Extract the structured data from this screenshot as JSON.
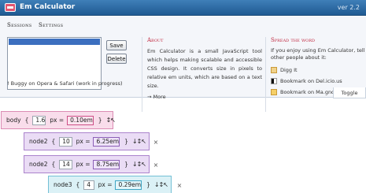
{
  "app": {
    "title": "Em Calculator",
    "version": "ver 2.2",
    "brand_color": "#2a6aa3",
    "accent_color": "#c0283f",
    "logo_icon": "em-logo-icon"
  },
  "nav": {
    "items": [
      "Sessions",
      "Settings"
    ]
  },
  "sessions": {
    "save_label": "Save",
    "delete_label": "Delete",
    "warning": "! Buggy on Opera & Safari (work in progress)"
  },
  "about": {
    "title": "About",
    "text": "Em Calculator is a small JavaScript tool which helps making scalable and accessible CSS design. It converts size in pixels to relative em units, which are based on a text size.",
    "more": "→ More"
  },
  "spread": {
    "title": "Spread the word",
    "text": "If you enjoy using Em Calculator, tell other people about it:",
    "items": [
      {
        "label": "Digg It",
        "icon": "digg-icon"
      },
      {
        "label": "Bookmark on Del.icio.us",
        "icon": "delicious-icon"
      },
      {
        "label": "Bookmark on Ma.gnolia",
        "icon": "magnolia-icon"
      }
    ]
  },
  "toggle_label": "Toggle",
  "nodes": [
    {
      "name": "body",
      "open": "{",
      "value": "1.6",
      "px": "px =",
      "em": "0.10em",
      "close": "}",
      "ctrl": "↕↖",
      "color": "#f9ddeb"
    },
    {
      "name": "node2",
      "open": "{",
      "value": "10",
      "px": "px =",
      "em": "6.25em",
      "close": "}",
      "ctrl": "↓↕↖",
      "remove": "×",
      "color": "#eadcf5"
    },
    {
      "name": "node2",
      "open": "{",
      "value": "14",
      "px": "px =",
      "em": "8.75em",
      "close": "}",
      "ctrl": "↓↕↖",
      "remove": "×",
      "color": "#eadcf5"
    },
    {
      "name": "node3",
      "open": "{",
      "value": "4",
      "px": "px =",
      "em": "0.29em",
      "close": "}",
      "ctrl": "↓↕↖",
      "remove": "×",
      "color": "#dbf1f6"
    }
  ]
}
